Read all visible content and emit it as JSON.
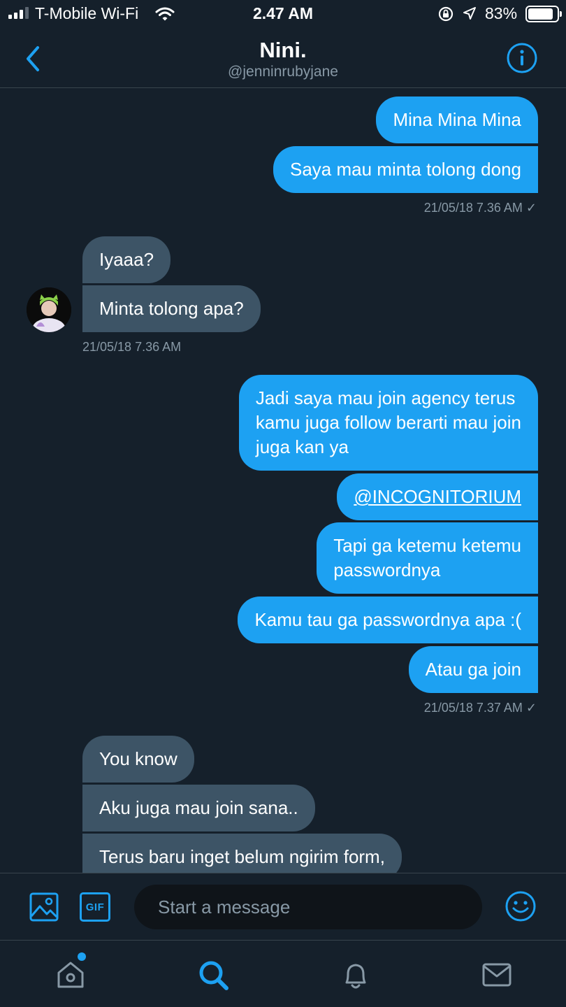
{
  "status_bar": {
    "carrier": "T-Mobile Wi-Fi",
    "time": "2.47 AM",
    "battery": "83%",
    "icons": [
      "signal-icon",
      "wifi-icon",
      "rotation-lock-icon",
      "location-arrow-icon",
      "battery-icon"
    ]
  },
  "header": {
    "name": "Nini.",
    "handle": "@jenninrubyjane",
    "icons": [
      "back-chevron-icon",
      "info-icon"
    ]
  },
  "messages": {
    "group1": {
      "m1": "Mina Mina Mina",
      "m2": "Saya mau minta tolong dong",
      "ts": "21/05/18 7.36 AM ✓"
    },
    "group2": {
      "m1": "Iyaaa?",
      "m2": "Minta tolong apa?",
      "ts": "21/05/18 7.36 AM"
    },
    "group3": {
      "m1_line1": "Jadi saya mau join agency terus",
      "m1_line2": "kamu juga follow berarti mau join",
      "m1_line3": "juga kan ya",
      "m2": "@INCOGNITORIUM",
      "m3_line1": "Tapi ga ketemu ketemu",
      "m3_line2": "passwordnya",
      "m4": "Kamu tau ga passwordnya apa :(",
      "m5": "Atau ga join",
      "ts": "21/05/18 7.37 AM ✓"
    },
    "group4": {
      "m1": "You know",
      "m2": "Aku juga mau join sana..",
      "m3": "Terus baru inget belum ngirim form,"
    }
  },
  "composer": {
    "gif_label": "GIF",
    "placeholder": "Start a message",
    "icons": [
      "image-icon",
      "gif-icon",
      "emoji-icon"
    ]
  },
  "tabbar": {
    "items": [
      "home-icon",
      "search-icon",
      "notifications-icon",
      "messages-icon"
    ]
  },
  "colors": {
    "background": "#15202b",
    "accent": "#1da1f2",
    "incoming_bubble": "#3d5466",
    "muted_text": "#8899a6"
  }
}
